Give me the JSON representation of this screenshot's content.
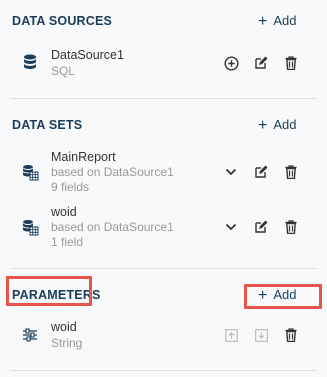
{
  "data_sources": {
    "title": "DATA SOURCES",
    "add_label": "Add",
    "items": [
      {
        "name": "DataSource1",
        "type": "SQL"
      }
    ]
  },
  "data_sets": {
    "title": "DATA SETS",
    "add_label": "Add",
    "items": [
      {
        "name": "MainReport",
        "based_on": "based on DataSource1",
        "fields": "9 fields"
      },
      {
        "name": "woid",
        "based_on": "based on DataSource1",
        "fields": "1 field"
      }
    ]
  },
  "parameters": {
    "title": "PARAMETERS",
    "add_label": "Add",
    "items": [
      {
        "name": "woid",
        "type": "String"
      }
    ]
  },
  "colors": {
    "accent": "#1a3d5c",
    "highlight": "#e8544a",
    "muted": "#999999"
  }
}
